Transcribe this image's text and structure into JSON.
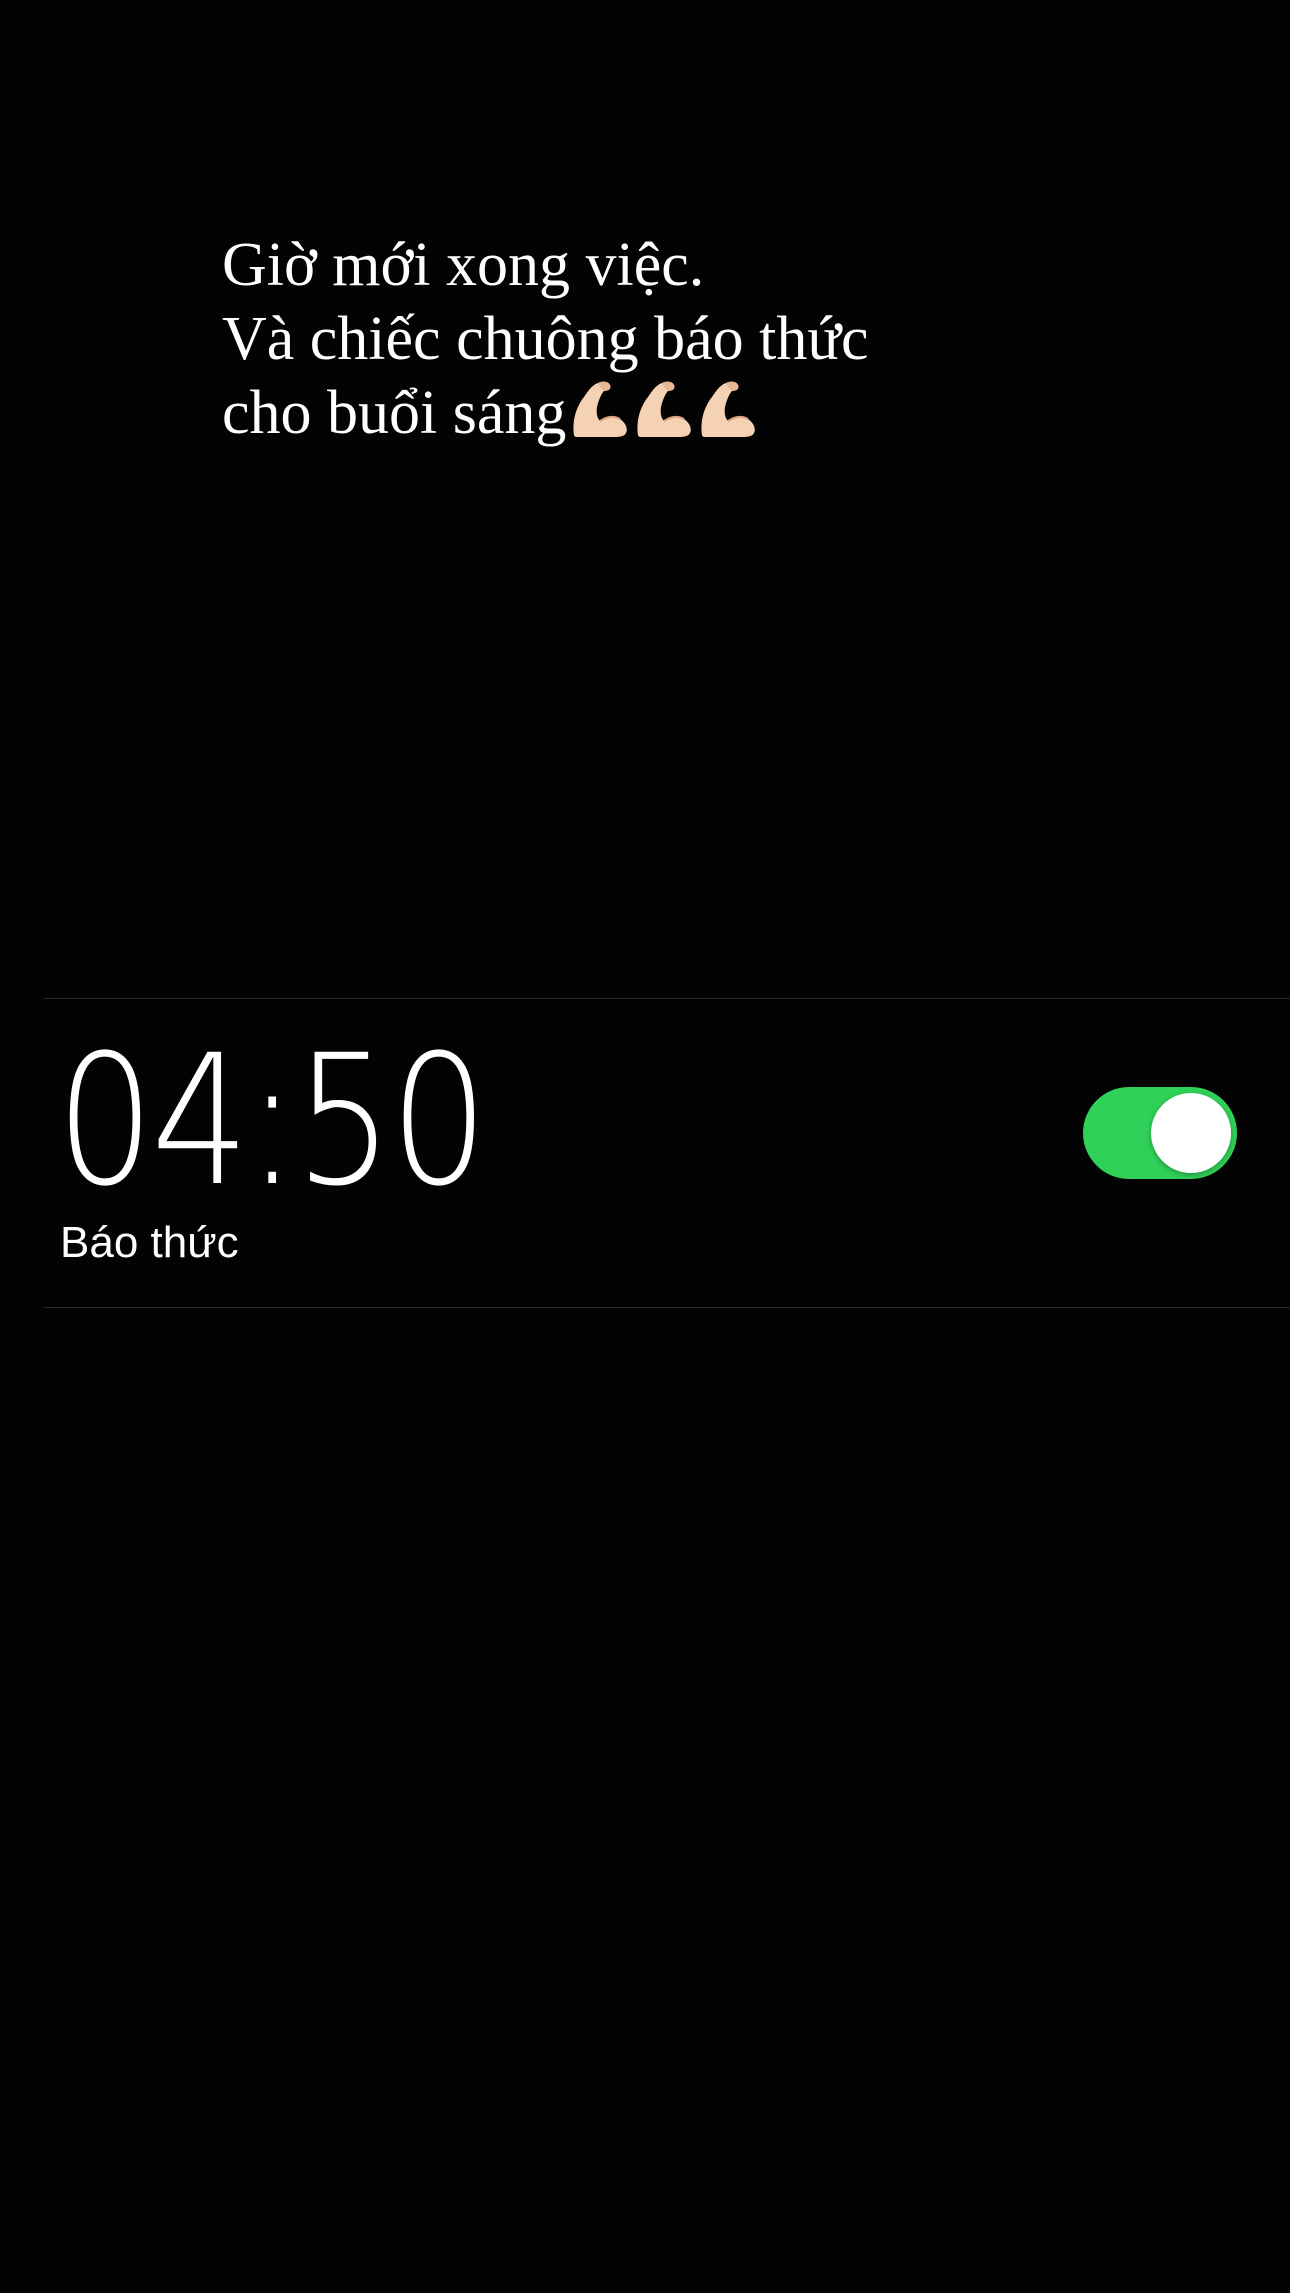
{
  "caption": {
    "line1": "Giờ mới xong việc.",
    "line2": "Và chiếc chuông báo thức",
    "line3": "cho buổi sáng",
    "emoji": [
      "flexed-biceps-icon",
      "flexed-biceps-icon",
      "flexed-biceps-icon"
    ]
  },
  "alarm": {
    "time": "04:50",
    "label": "Báo thức",
    "enabled": true
  },
  "colors": {
    "background": "#030303",
    "toggle_on": "#30d158",
    "text": "#ffffff",
    "divider": "#2a2a2a",
    "emoji_skin": "#f6d2b4"
  }
}
